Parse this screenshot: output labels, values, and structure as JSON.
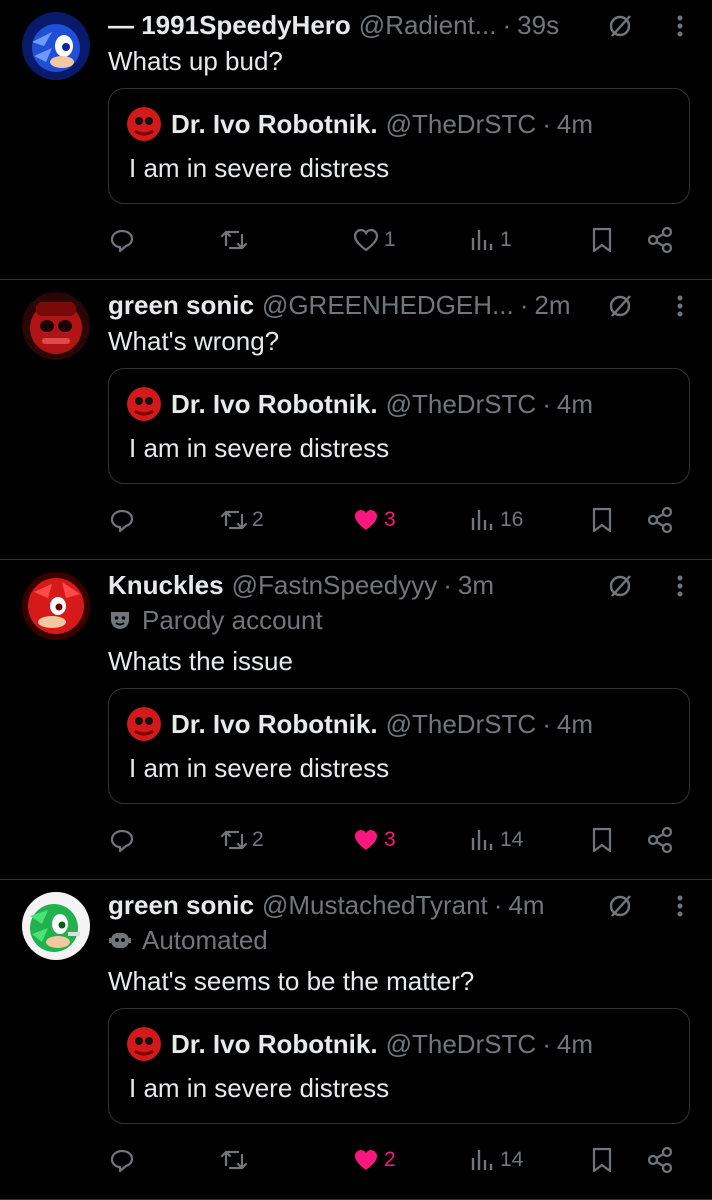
{
  "colors": {
    "background": "#000000",
    "text": "#e7e9ea",
    "muted": "#71767b",
    "border": "#2f3336",
    "like_pink": "#f91880"
  },
  "posts": [
    {
      "display_name": "— 1991SpeedyHero",
      "handle": "@Radient...",
      "separator": "·",
      "time": "39s",
      "label": "",
      "text": "Whats up bud?",
      "avatar_icon": "sonic-avatar",
      "quote": {
        "display_name": "Dr. Ivo Robotnik.",
        "handle": "@TheDrSTC",
        "separator": "·",
        "time": "4m",
        "text": "I am in severe distress"
      },
      "actions": {
        "reply": "",
        "repost": "",
        "like": "1",
        "views": "1",
        "liked": false
      }
    },
    {
      "display_name": "green sonic",
      "handle": "@GREENHEDGEH...",
      "separator": "·",
      "time": "2m",
      "label": "",
      "text": "What's wrong?",
      "avatar_icon": "red-robot-avatar",
      "quote": {
        "display_name": "Dr. Ivo Robotnik.",
        "handle": "@TheDrSTC",
        "separator": "·",
        "time": "4m",
        "text": "I am in severe distress"
      },
      "actions": {
        "reply": "",
        "repost": "2",
        "like": "3",
        "views": "16",
        "liked": true
      }
    },
    {
      "display_name": "Knuckles",
      "handle": "@FastnSpeedyyy",
      "separator": "·",
      "time": "3m",
      "label": "Parody account",
      "label_icon": "parody-mask-icon",
      "text": "Whats the issue",
      "avatar_icon": "knuckles-avatar",
      "quote": {
        "display_name": "Dr. Ivo Robotnik.",
        "handle": "@TheDrSTC",
        "separator": "·",
        "time": "4m",
        "text": "I am in severe distress"
      },
      "actions": {
        "reply": "",
        "repost": "2",
        "like": "3",
        "views": "14",
        "liked": true
      }
    },
    {
      "display_name": "green sonic",
      "handle": "@MustachedTyrant",
      "separator": "·",
      "time": "4m",
      "label": "Automated",
      "label_icon": "bot-icon",
      "text": "What's seems to be the matter?",
      "avatar_icon": "green-sonic-avatar",
      "quote": {
        "display_name": "Dr. Ivo Robotnik.",
        "handle": "@TheDrSTC",
        "separator": "·",
        "time": "4m",
        "text": "I am in severe distress"
      },
      "actions": {
        "reply": "",
        "repost": "",
        "like": "2",
        "views": "14",
        "liked": true
      }
    }
  ]
}
